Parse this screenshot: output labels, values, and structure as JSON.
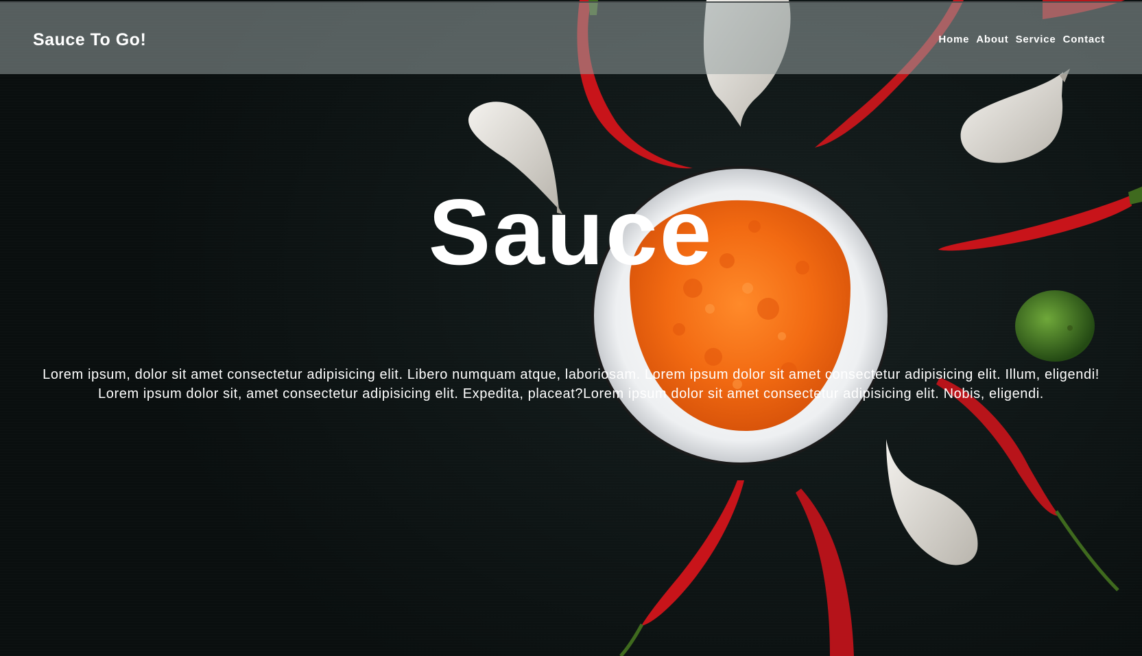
{
  "header": {
    "brand": "Sauce To Go!",
    "nav": [
      "Home",
      "About",
      "Service",
      "Contact"
    ]
  },
  "hero": {
    "title": "Sauce",
    "body": "Lorem ipsum, dolor sit amet consectetur adipisicing elit. Libero numquam atque, laboriosam. Lorem ipsum dolor sit amet consectetur adipisicing elit. Illum, eligendi! Lorem ipsum dolor sit, amet consectetur adipisicing elit. Expedita, placeat?Lorem ipsum dolor sit amet consectetur adipisicing elit. Nobis, eligendi."
  },
  "colors": {
    "background": "#0c1212",
    "header_overlay": "rgba(150,160,160,0.55)",
    "text": "#ffffff",
    "sauce": "#f26a12",
    "chili": "#c8141a"
  },
  "icons": [
    "garlic-clove",
    "red-chili-pepper",
    "sauce-bowl",
    "lime"
  ]
}
